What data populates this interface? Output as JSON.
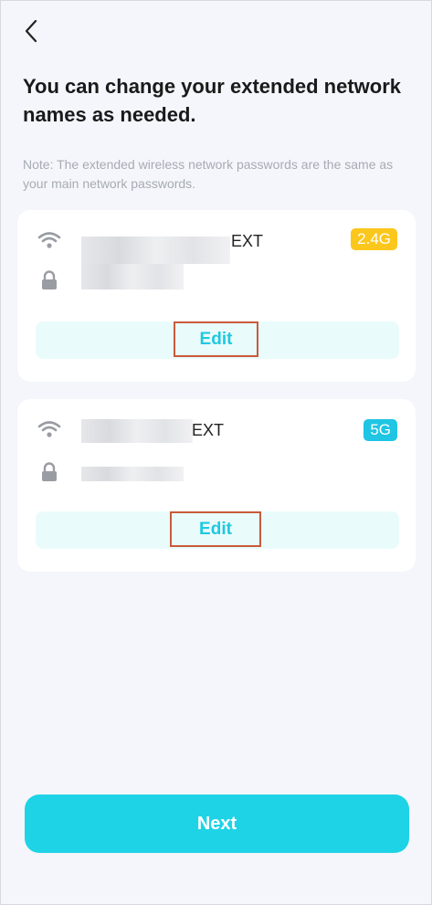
{
  "header": {
    "back_icon": "chevron-left-icon"
  },
  "title": "You can change your extended network names as needed.",
  "note": "Note: The extended wireless network passwords are the same as your main network passwords.",
  "networks": [
    {
      "ssid_suffix": "EXT",
      "band": "2.4G",
      "band_color": "#fcc71c",
      "edit_label": "Edit"
    },
    {
      "ssid_suffix": "EXT",
      "band": "5G",
      "band_color": "#1fc5e3",
      "edit_label": "Edit"
    }
  ],
  "next_label": "Next",
  "colors": {
    "accent": "#1fd3e6",
    "edit_text": "#1ec9e0",
    "highlight_border": "#c85b3a"
  }
}
